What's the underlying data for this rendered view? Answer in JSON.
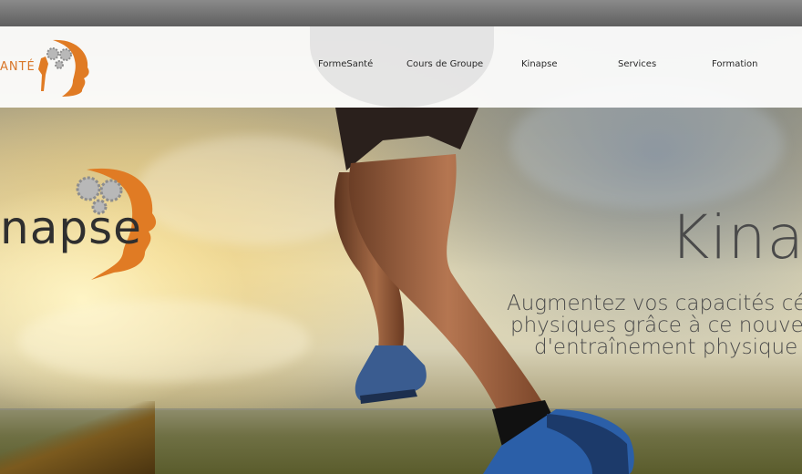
{
  "header": {
    "brand_text": "ANTÉ",
    "nav": [
      {
        "label": "FormeSanté"
      },
      {
        "label": "Cours de Groupe"
      },
      {
        "label": "Kinapse"
      },
      {
        "label": "Services"
      },
      {
        "label": "Formation"
      }
    ]
  },
  "hero": {
    "logo_text": "napse",
    "title": "Kinap",
    "subtitle_lines": [
      "Augmentez vos capacités céréb",
      "physiques grâce à ce nouveau c",
      "d'entraînement physique et c"
    ]
  },
  "colors": {
    "brand_orange": "#e07b24",
    "nav_text": "#2a2a2a",
    "hero_text": "#4a4a4a"
  }
}
